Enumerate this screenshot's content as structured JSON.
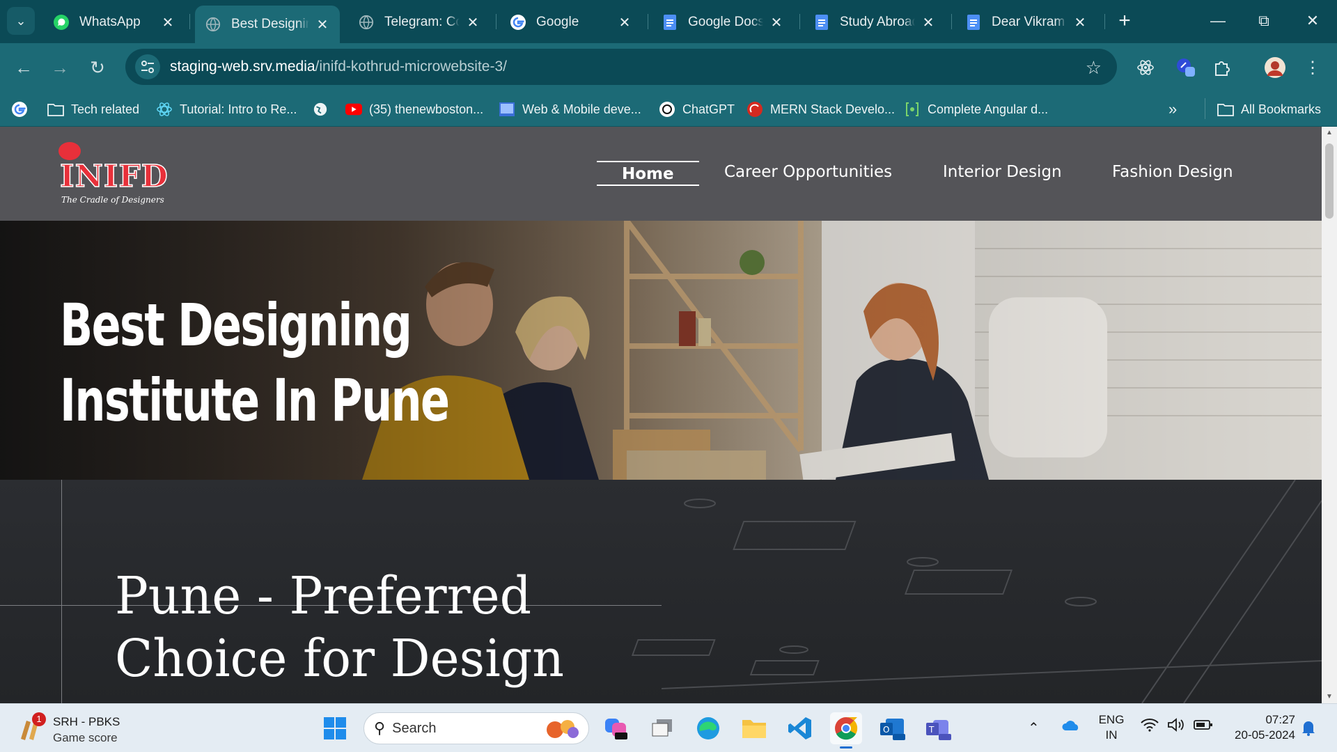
{
  "browser": {
    "tabs": [
      {
        "title": "WhatsApp",
        "icon": "whatsapp-icon",
        "active": false
      },
      {
        "title": "Best Designing",
        "icon": "globe-icon",
        "active": true
      },
      {
        "title": "Telegram: Con",
        "icon": "globe-icon",
        "active": false
      },
      {
        "title": "Google",
        "icon": "google-icon",
        "active": false
      },
      {
        "title": "Google Docs",
        "icon": "docs-icon",
        "active": false
      },
      {
        "title": "Study Abroad",
        "icon": "docs-icon",
        "active": false
      },
      {
        "title": "Dear Vikram S",
        "icon": "docs-icon",
        "active": false
      }
    ],
    "url_host": "staging-web.srv.media",
    "url_path": "/inifd-kothrud-microwebsite-3/",
    "bookmarks": [
      {
        "label": "Tech related",
        "icon": "folder-icon"
      },
      {
        "label": "Tutorial: Intro to Re...",
        "icon": "react-icon"
      },
      {
        "label": "(35) thenewboston...",
        "icon": "youtube-icon"
      },
      {
        "label": "Web & Mobile deve...",
        "icon": "bookmark-icon"
      },
      {
        "label": "ChatGPT",
        "icon": "chatgpt-icon"
      },
      {
        "label": "MERN Stack Develo...",
        "icon": "bookmark-icon"
      },
      {
        "label": "Complete Angular d...",
        "icon": "bookmark-icon"
      }
    ],
    "all_bookmarks_label": "All Bookmarks"
  },
  "site": {
    "logo_text": "INIFD",
    "logo_tagline": "The Cradle of Designers",
    "nav": [
      "Home",
      "Career Opportunities",
      "Interior Design",
      "Fashion Design"
    ],
    "hero_title_line1": "Best Designing",
    "hero_title_line2": "Institute In Pune",
    "section_title_line1": "Pune - Preferred",
    "section_title_line2": "Choice for Design"
  },
  "taskbar": {
    "widget_title": "SRH - PBKS",
    "widget_subtitle": "Game score",
    "widget_badge": "1",
    "search_placeholder": "Search",
    "lang_line1": "ENG",
    "lang_line2": "IN",
    "time": "07:27",
    "date": "20-05-2024"
  },
  "colors": {
    "chrome_dark": "#0b4a56",
    "chrome_toolbar": "#1c6a76",
    "site_header": "#545458",
    "logo_red": "#e8303a"
  }
}
